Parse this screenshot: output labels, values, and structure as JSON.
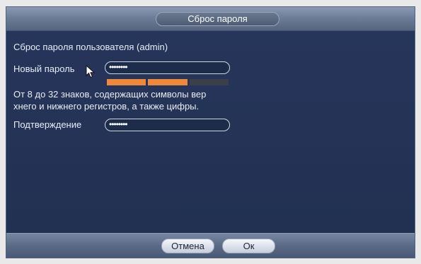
{
  "dialog": {
    "title": "Сброс пароля"
  },
  "form": {
    "heading": "Сброс пароля пользователя (admin)",
    "new_password_label": "Новый пароль",
    "new_password_value": "••••••••",
    "password_strength": {
      "filled_segments": 2,
      "total_segments": 3,
      "colors": {
        "filled": "#f0883a",
        "empty": "#3a3f4a"
      }
    },
    "hint_line1": "От 8 до 32 знаков, содержащих символы вер",
    "hint_line2": "хнего и нижнего регистров, а также цифры.",
    "confirm_label": "Подтверждение",
    "confirm_value": "••••••••"
  },
  "footer": {
    "cancel_label": "Отмена",
    "ok_label": "Ок"
  },
  "colors": {
    "panel": "#26355a",
    "accent_orange": "#f0883a",
    "text": "#e8edf6"
  }
}
